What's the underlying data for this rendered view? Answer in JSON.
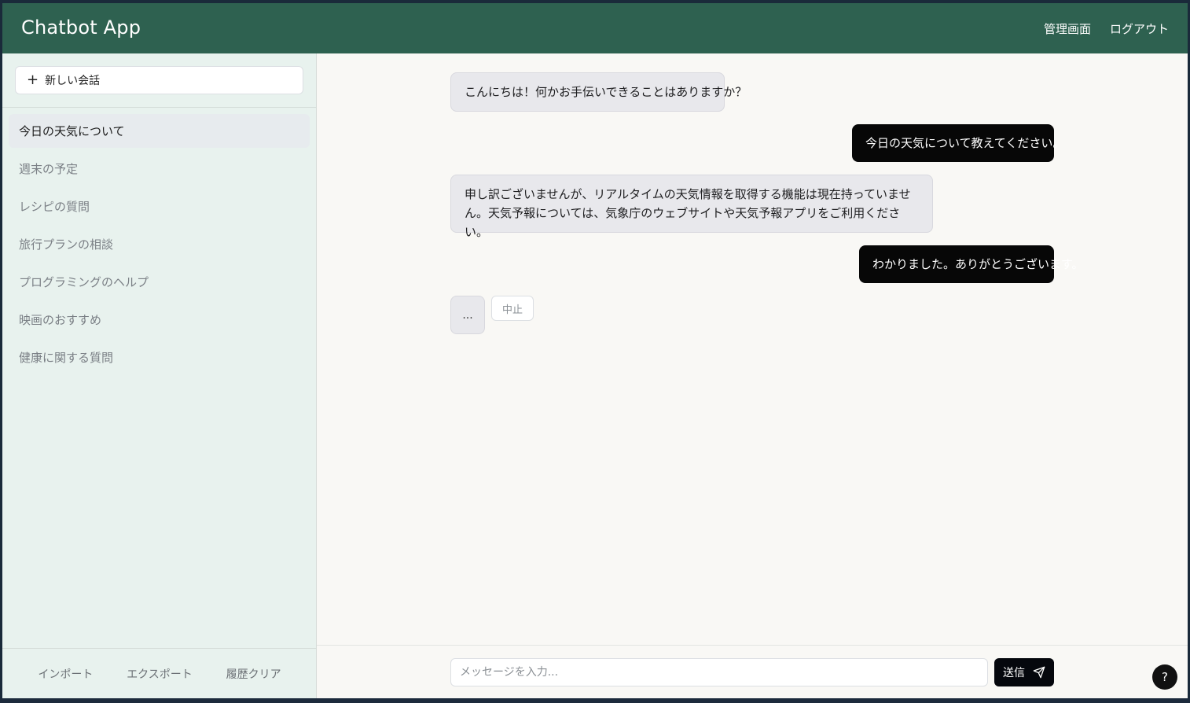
{
  "header": {
    "title": "Chatbot App",
    "nav": [
      "管理画面",
      "ログアウト"
    ]
  },
  "sidebar": {
    "new_chat_label": "新しい会話",
    "new_chat_icon": "plus-icon",
    "conversations": [
      "今日の天気について",
      "週末の予定",
      "レシピの質問",
      "旅行プランの相談",
      "プログラミングのヘルプ",
      "映画のおすすめ",
      "健康に関する質問"
    ],
    "active_index": 0,
    "footer": [
      "インポート",
      "エクスポート",
      "履歴クリア"
    ]
  },
  "chat": {
    "messages": [
      {
        "role": "assistant",
        "text": "こんにちは！何かお手伝いできることはありますか？"
      },
      {
        "role": "user",
        "text": "今日の天気について教えてください。"
      },
      {
        "role": "assistant",
        "text": "申し訳ございませんが、リアルタイムの天気情報を取得する機能は現在持っていません。天気予報については、気象庁のウェブサイトや天気予報アプリをご利用ください。"
      },
      {
        "role": "user",
        "text": "わかりました。ありがとうございます。"
      }
    ],
    "typing_indicator": "...",
    "stop_label": "中止"
  },
  "composer": {
    "placeholder": "メッセージを入力...",
    "send_label": "送信",
    "send_icon": "send-icon"
  },
  "help": {
    "label": "?"
  },
  "colors": {
    "header_bg": "#2e6150",
    "sidebar_bg": "#e8f2ee",
    "main_bg": "#f9f8f5",
    "user_bubble": "#070707",
    "bot_bubble": "#e8e8ec"
  }
}
